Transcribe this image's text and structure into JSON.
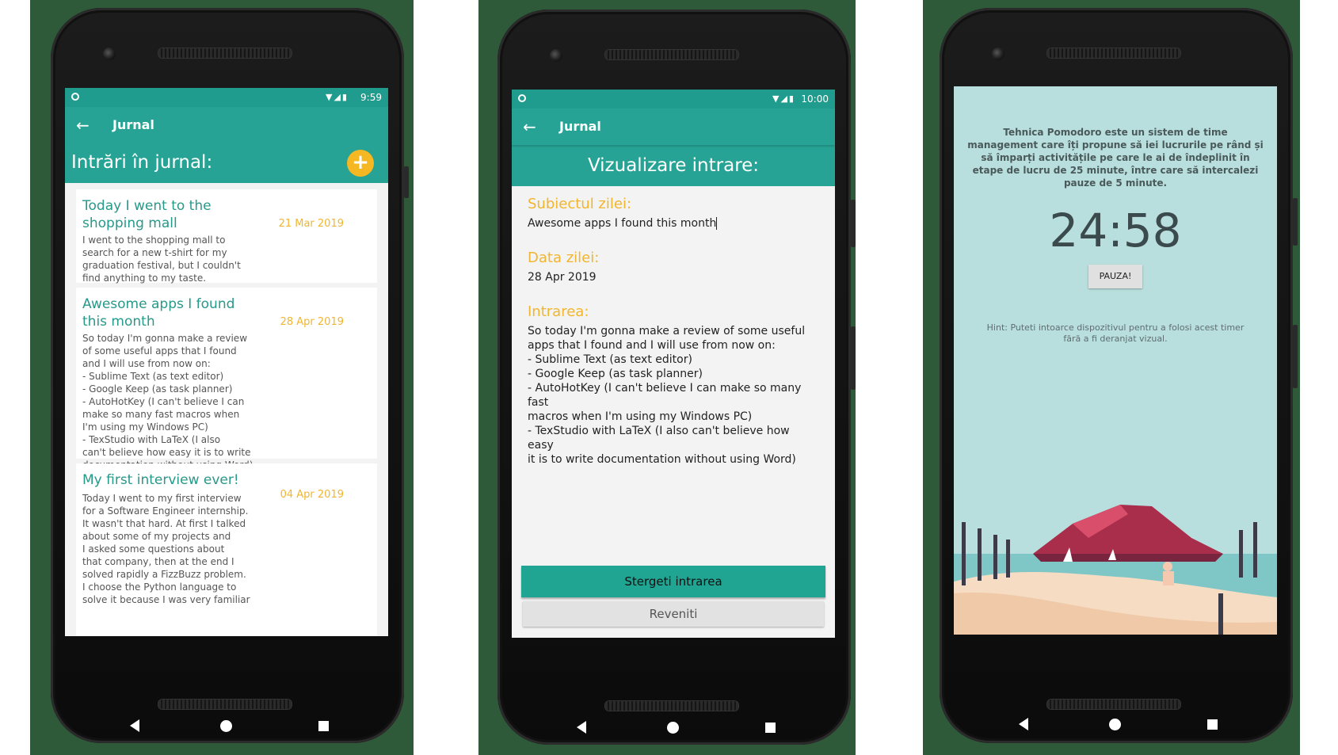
{
  "phone1": {
    "status_time": "9:59",
    "app_title": "Jurnal",
    "subheader": "Intrări în jurnal:",
    "add_icon": "plus-icon",
    "entries": [
      {
        "title": "Today I went to the shopping mall",
        "date": "21 Mar 2019",
        "body": "I went to the shopping mall to\nsearch for a new t-shirt for my\ngraduation festival, but I couldn't\nfind anything to my taste."
      },
      {
        "title": "Awesome apps I found this month",
        "date": "28 Apr 2019",
        "body": "So today I'm gonna make a review\nof some useful apps that I found\nand I will use from now on:\n- Sublime Text (as text editor)\n- Google Keep (as task planner)\n- AutoHotKey (I can't believe I can\nmake so many fast macros when\nI'm using my Windows PC)\n- TexStudio with LaTeX (I also\ncan't believe how easy it is to write\ndocumentation without using Word)"
      },
      {
        "title": "My first interview ever!",
        "date": "04 Apr 2019",
        "body": "Today I went to my first interview\nfor a Software Engineer internship.\nIt wasn't that hard. At first I talked\nabout some of my projects and\nI asked some questions about\nthat company, then at the end I\nsolved rapidly a FizzBuzz problem.\nI choose the Python language to\nsolve it because I was very familiar"
      }
    ]
  },
  "phone2": {
    "status_time": "10:00",
    "app_title": "Jurnal",
    "subheader": "Vizualizare intrare:",
    "subject_label": "Subiectul zilei:",
    "subject_value": "Awesome apps I found this month",
    "date_label": "Data zilei:",
    "date_value": "28 Apr 2019",
    "entry_label": "Intrarea:",
    "entry_value": "So today I'm gonna make a review of some useful\napps that I found and I will use from now on:\n- Sublime Text (as text editor)\n- Google Keep (as task planner)\n- AutoHotKey (I can't believe I can make so many fast\nmacros when I'm using my Windows PC)\n- TexStudio with LaTeX (I also can't believe how easy\nit is to write documentation without using Word)",
    "delete_button": "Stergeti intrarea",
    "back_button": "Reveniti"
  },
  "phone3": {
    "intro": "Tehnica Pomodoro este un sistem de time management care îți propune să iei lucrurile pe rând și să împarți activitățile pe care le ai de îndeplinit în etape de lucru de 25 minute, între care să intercalezi pauze de 5 minute.",
    "timer": "24:58",
    "pause_button": "PAUZA!",
    "hint": "Hint: Puteti intoarce dispozitivul pentru a folosi acest timer fără a fi deranjat vizual."
  },
  "icons": {
    "back": "arrow-left-icon",
    "nav_back": "triangle-back-icon",
    "nav_home": "circle-home-icon",
    "nav_recent": "square-recent-icon"
  },
  "colors": {
    "teal": "#26a394",
    "amber": "#f2b52e",
    "timer_bg": "#b8dedd"
  }
}
